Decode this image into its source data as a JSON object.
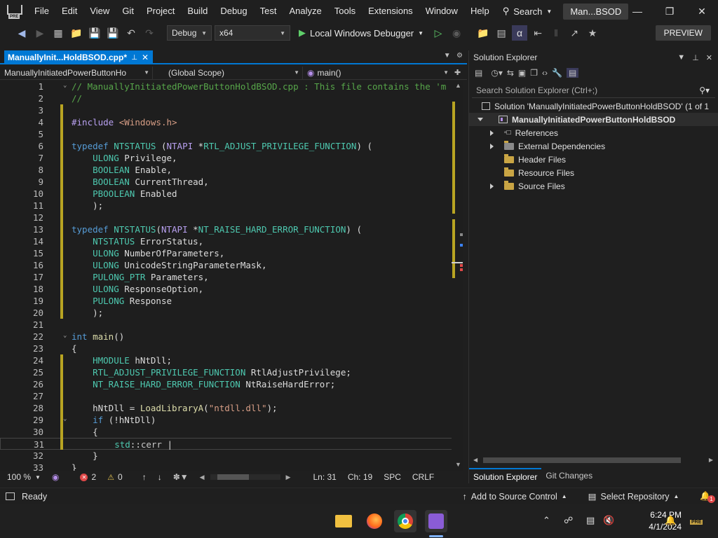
{
  "menubar": {
    "items": [
      "File",
      "Edit",
      "View",
      "Git",
      "Project",
      "Build",
      "Debug",
      "Test",
      "Analyze",
      "Tools",
      "Extensions",
      "Window",
      "Help"
    ],
    "search_label": "Search",
    "title": "Man...BSOD"
  },
  "toolbar": {
    "config": "Debug",
    "platform": "x64",
    "debugger": "Local Windows Debugger",
    "preview_label": "PREVIEW"
  },
  "editor": {
    "tab_label": "ManuallyInit...HoldBSOD.cpp*",
    "nav_project": "ManuallyInitiatedPowerButtonHo",
    "nav_scope": "(Global Scope)",
    "nav_member": "main()",
    "lines": [
      {
        "n": "1",
        "html": "<span class='c'>// ManuallyInitiatedPowerButtonHoldBSOD.cpp : This file contains the 'm</span>"
      },
      {
        "n": "2",
        "html": "<span class='c'>//</span>"
      },
      {
        "n": "3",
        "html": ""
      },
      {
        "n": "4",
        "html": "<span class='p'>#include</span> <span class='s'>&lt;Windows.h&gt;</span>"
      },
      {
        "n": "5",
        "html": ""
      },
      {
        "n": "6",
        "html": "<span class='k'>typedef</span> <span class='t'>NTSTATUS</span> (<span class='p'>NTAPI</span> *<span class='t'>RTL_ADJUST_PRIVILEGE_FUNCTION</span>) ("
      },
      {
        "n": "7",
        "html": "    <span class='t'>ULONG</span> Privilege,"
      },
      {
        "n": "8",
        "html": "    <span class='t'>BOOLEAN</span> Enable,"
      },
      {
        "n": "9",
        "html": "    <span class='t'>BOOLEAN</span> CurrentThread,"
      },
      {
        "n": "10",
        "html": "    <span class='t'>PBOOLEAN</span> Enabled"
      },
      {
        "n": "11",
        "html": "    );"
      },
      {
        "n": "12",
        "html": ""
      },
      {
        "n": "13",
        "html": "<span class='k'>typedef</span> <span class='t'>NTSTATUS</span>(<span class='p'>NTAPI</span> *<span class='t'>NT_RAISE_HARD_ERROR_FUNCTION</span>) ("
      },
      {
        "n": "14",
        "html": "    <span class='t'>NTSTATUS</span> ErrorStatus,"
      },
      {
        "n": "15",
        "html": "    <span class='t'>ULONG</span> NumberOfParameters,"
      },
      {
        "n": "16",
        "html": "    <span class='t'>ULONG</span> UnicodeStringParameterMask,"
      },
      {
        "n": "17",
        "html": "    <span class='t'>PULONG_PTR</span> Parameters,"
      },
      {
        "n": "18",
        "html": "    <span class='t'>ULONG</span> ResponseOption,"
      },
      {
        "n": "19",
        "html": "    <span class='t'>PULONG</span> Response"
      },
      {
        "n": "20",
        "html": "    );"
      },
      {
        "n": "21",
        "html": ""
      },
      {
        "n": "22",
        "html": "<span class='k'>int</span> <span class='fn'>main</span>()"
      },
      {
        "n": "23",
        "html": "{"
      },
      {
        "n": "24",
        "html": "    <span class='t'>HMODULE</span> hNtDll;"
      },
      {
        "n": "25",
        "html": "    <span class='t'>RTL_ADJUST_PRIVILEGE_FUNCTION</span> RtlAdjustPrivilege;"
      },
      {
        "n": "26",
        "html": "    <span class='t'>NT_RAISE_HARD_ERROR_FUNCTION</span> NtRaiseHardError;"
      },
      {
        "n": "27",
        "html": ""
      },
      {
        "n": "28",
        "html": "    hNtDll = <span class='fn'>LoadLibraryA</span>(<span class='s'>\"ntdll.dll\"</span>);"
      },
      {
        "n": "29",
        "html": "    <span class='k'>if</span> (!hNtDll)"
      },
      {
        "n": "30",
        "html": "    {"
      },
      {
        "n": "31",
        "html": "        <span class='t'>std</span>::<span class='m'>cerr</span> |"
      },
      {
        "n": "32",
        "html": "    }"
      },
      {
        "n": "33",
        "html": "}"
      }
    ]
  },
  "editor_status": {
    "zoom": "100 %",
    "errors": "2",
    "warnings": "0",
    "line": "Ln: 31",
    "col": "Ch: 19",
    "spacing": "SPC",
    "eol": "CRLF"
  },
  "solution_explorer": {
    "title": "Solution Explorer",
    "search_placeholder": "Search Solution Explorer (Ctrl+;)",
    "solution_label": "Solution 'ManuallyInitiatedPowerButtonHoldBSOD' (1 of 1",
    "project_label": "ManuallyInitiatedPowerButtonHoldBSOD",
    "items": [
      {
        "label": "References",
        "expandable": true
      },
      {
        "label": "External Dependencies",
        "expandable": true
      },
      {
        "label": "Header Files",
        "expandable": false
      },
      {
        "label": "Resource Files",
        "expandable": false
      },
      {
        "label": "Source Files",
        "expandable": true
      }
    ],
    "tabs": [
      "Solution Explorer",
      "Git Changes"
    ]
  },
  "statusbar": {
    "ready": "Ready",
    "source_control": "Add to Source Control",
    "repository": "Select Repository",
    "notification_count": "1"
  },
  "taskbar": {
    "time": "6:24 PM",
    "date": "4/1/2024"
  },
  "colors": {
    "accent": "#0078d4",
    "change_bar": "#b8a422",
    "error": "#e04848"
  }
}
